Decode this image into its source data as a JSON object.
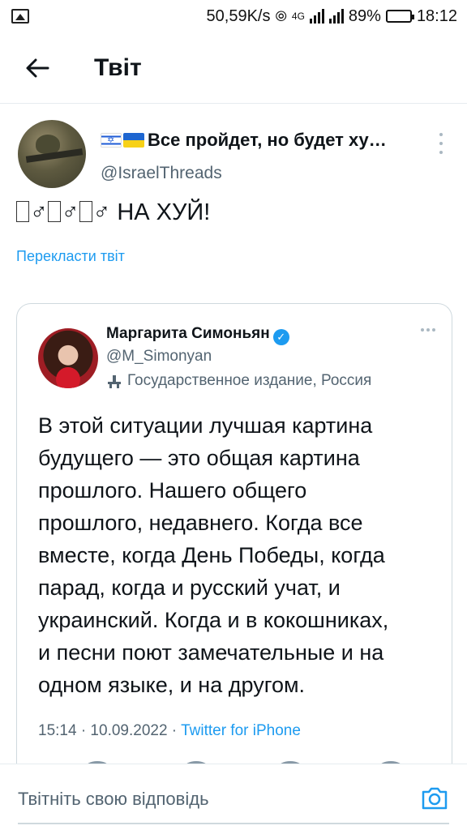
{
  "status_bar": {
    "net_speed": "50,59K/s",
    "network_type": "4G",
    "battery_percent": "89%",
    "time": "18:12",
    "battery_level": 0.89
  },
  "header": {
    "title": "Твіт",
    "back_icon": "arrow-left-icon"
  },
  "tweet": {
    "author_name": "Все пройдет, но будет ху…",
    "author_handle": "@IsraelThreads",
    "text": "НА ХУЙ!",
    "unrendered_glyph_count": 2,
    "male_sign": "♂",
    "translate_link": "Перекласти твіт"
  },
  "quoted_tweet": {
    "author_name": "Маргарита Симоньян",
    "author_handle": "@M_Simonyan",
    "account_label": "Государственное издание, Россия",
    "text_lines": [
      "В этой ситуации лучшая картина",
      "будущего — это общая картина",
      "прошлого. Нашего общего",
      "прошлого, недавнего. Когда все",
      "вместе, когда День Победы, когда",
      "парад, когда и русский учат, и",
      "украинский. Когда и в кокошниках,",
      "и песни поют замечательные и на",
      "одном языке, и на другом."
    ],
    "timestamp": "15:14 · 10.09.2022 · ",
    "source": "Twitter for iPhone"
  },
  "reply_bar": {
    "placeholder": "Твітніть свою відповідь",
    "camera_icon": "camera-icon"
  },
  "colors": {
    "accent": "#1d9bf0",
    "secondary_text": "#536471",
    "border": "#cfd9de"
  }
}
